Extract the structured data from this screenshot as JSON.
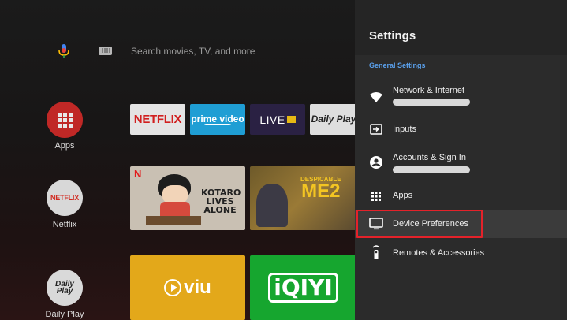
{
  "search": {
    "placeholder": "Search movies, TV, and more"
  },
  "rail": [
    {
      "label": "Apps"
    },
    {
      "label": "Netflix",
      "logo": "NETFLIX"
    },
    {
      "label": "Daily Play",
      "logo": "Daily Play"
    }
  ],
  "app_row": [
    {
      "logo": "NETFLIX"
    },
    {
      "logo": "prime video"
    },
    {
      "logo": "LIVE"
    },
    {
      "logo": "Daily Play"
    }
  ],
  "recommendations": {
    "kotaro": {
      "badge": "N",
      "title": "KOTARO LIVES ALONE"
    },
    "despicable": {
      "top": "DESPICABLE",
      "main": "ME2"
    }
  },
  "bottom_row": [
    {
      "logo": "viu"
    },
    {
      "logo": "iQIYI"
    }
  ],
  "settings": {
    "title": "Settings",
    "section": "General Settings",
    "items": [
      {
        "label": "Network & Internet",
        "icon": "wifi-icon"
      },
      {
        "label": "Inputs",
        "icon": "input-icon"
      },
      {
        "label": "Accounts & Sign In",
        "icon": "account-icon"
      },
      {
        "label": "Apps",
        "icon": "apps-grid-icon"
      },
      {
        "label": "Device Preferences",
        "icon": "tv-icon",
        "selected": true
      },
      {
        "label": "Remotes & Accessories",
        "icon": "remote-icon"
      }
    ]
  },
  "colors": {
    "focus_border": "#e4222a",
    "section_label": "#5aa0ec",
    "panel_bg": "#2b2b2b"
  }
}
